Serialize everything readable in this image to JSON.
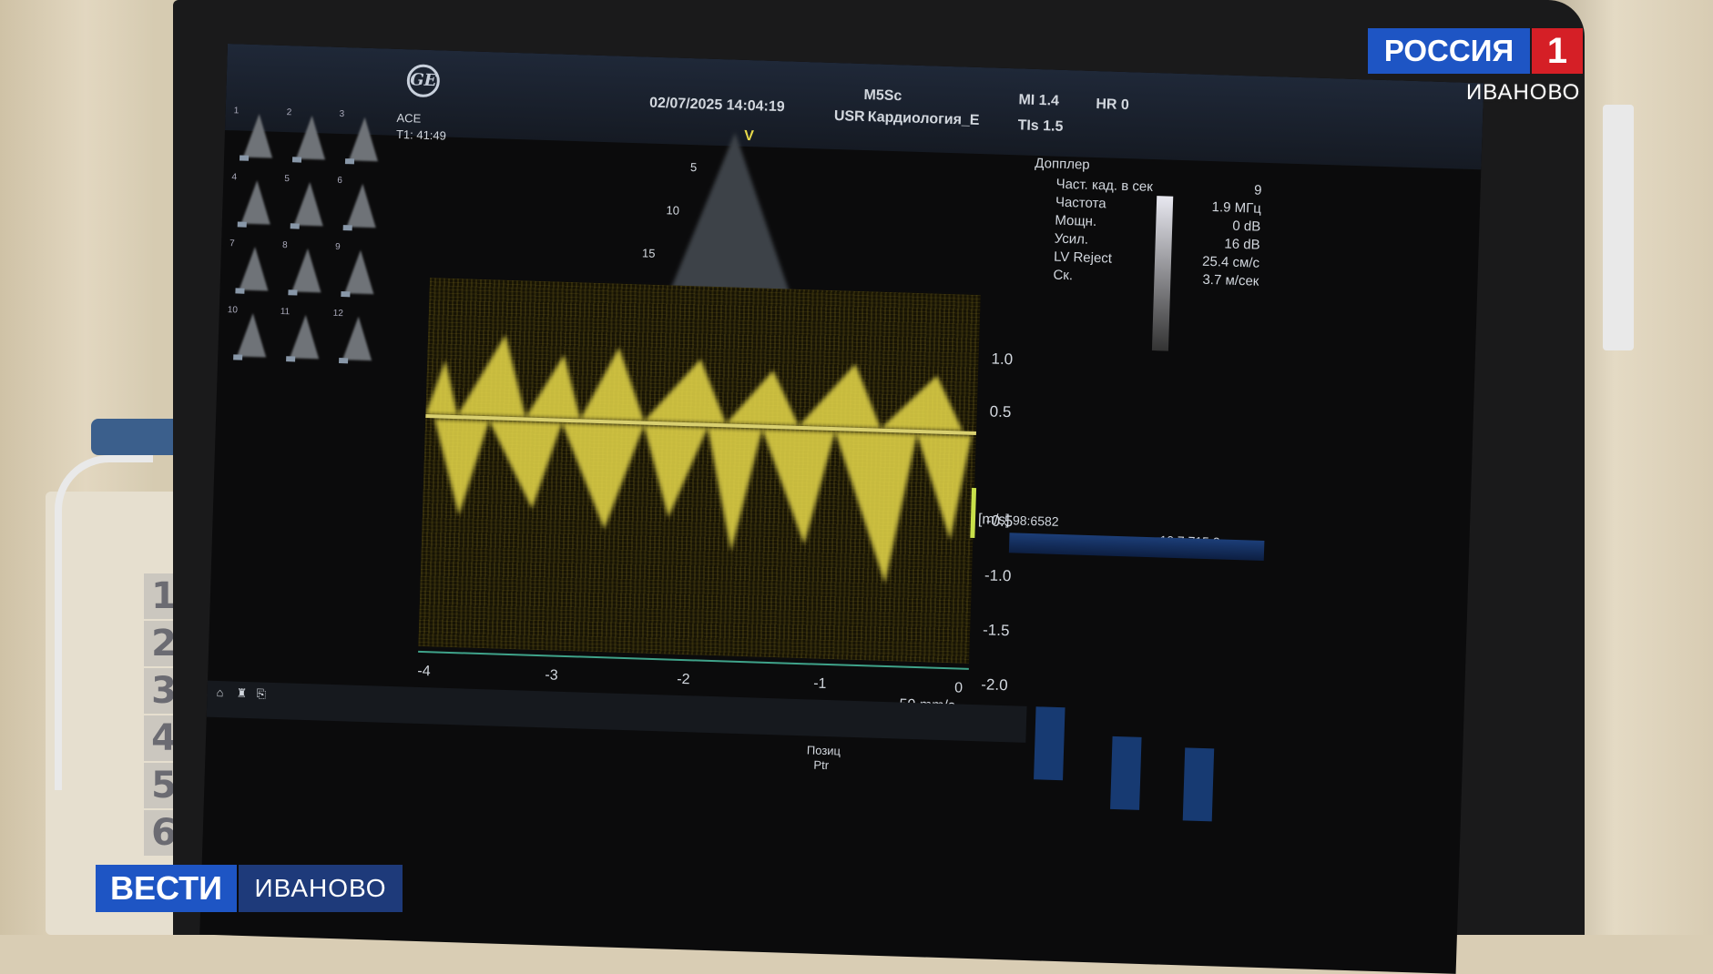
{
  "monitor": {
    "logo": "GE",
    "header": {
      "preset": "ACE",
      "timer": "T1: 41:49",
      "datetime": "02/07/2025 14:04:19",
      "probe": "M5Sc",
      "user": "USR",
      "study": "Кардиология_E",
      "mi": "MI 1.4",
      "tis": "TIs 1.5",
      "hr": "HR 0"
    },
    "thumbnails": [
      "1",
      "2",
      "3",
      "4",
      "5",
      "6",
      "7",
      "8",
      "9",
      "10",
      "11",
      "12"
    ],
    "sector": {
      "v_marker": "V",
      "depth_ticks": [
        "5",
        "10",
        "15"
      ]
    },
    "doppler": {
      "title": "Допплер",
      "params": [
        {
          "label": "Част. кад. в сек",
          "value": "9"
        },
        {
          "label": "Частота",
          "value": "1.9 МГц"
        },
        {
          "label": "Мощн.",
          "value": "0 dB"
        },
        {
          "label": "Усил.",
          "value": "16 dB"
        },
        {
          "label": "LV Reject",
          "value": "25.4 см/с"
        },
        {
          "label": "Ск.",
          "value": "3.7 м/сек"
        }
      ],
      "counter_left": "98:6582",
      "counter_right": "10.7:715.2s"
    },
    "velocity_axis": {
      "unit": "[m/s]",
      "ticks": [
        "1.0",
        "0.5",
        "-0.5",
        "-1.0",
        "-1.5",
        "-2.0"
      ]
    },
    "time_axis": {
      "ticks": [
        "-4",
        "-3",
        "-2",
        "-1",
        "0"
      ],
      "sweep": "50 mm/s"
    },
    "bottom_menu": {
      "item": "Позиц",
      "sub": "Ptr"
    }
  },
  "overlay": {
    "channel_top": {
      "name": "РОССИЯ",
      "number": "1",
      "city": "ИВАНОВО"
    },
    "channel_bottom": {
      "name": "ВЕСТИ",
      "city": "ИВАНОВО"
    }
  },
  "colors": {
    "spectrum": "#e6d84a",
    "accent_blue": "#1e55c4",
    "accent_red": "#d51f26"
  }
}
